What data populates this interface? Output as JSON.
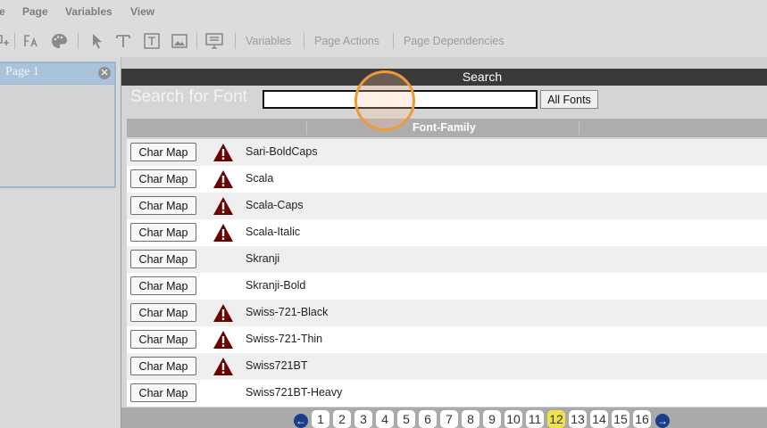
{
  "menu": {
    "items": [
      "e",
      "Page",
      "Variables",
      "View"
    ]
  },
  "toolbar": {
    "variables_label": "Variables",
    "page_actions_label": "Page Actions",
    "page_dependencies_label": "Page Dependencies"
  },
  "page_panel": {
    "title": "Page 1",
    "close_glyph": "✕"
  },
  "dialog": {
    "title": "Search",
    "search_label": "Search for Font",
    "search_value": "",
    "all_fonts_label": "All Fonts",
    "column_header": "Font-Family",
    "char_map_label": "Char Map",
    "rows": [
      {
        "name": "Sari-BoldCaps",
        "warning": true
      },
      {
        "name": "Scala",
        "warning": true
      },
      {
        "name": "Scala-Caps",
        "warning": true
      },
      {
        "name": "Scala-Italic",
        "warning": true
      },
      {
        "name": "Skranji",
        "warning": false
      },
      {
        "name": "Skranji-Bold",
        "warning": false
      },
      {
        "name": "Swiss-721-Black",
        "warning": true
      },
      {
        "name": "Swiss-721-Thin",
        "warning": true
      },
      {
        "name": "Swiss721BT",
        "warning": true
      },
      {
        "name": "Swiss721BT-Heavy",
        "warning": false
      }
    ],
    "warning_icon": "warning-triangle-icon"
  },
  "pagination": {
    "pages": [
      "1",
      "2",
      "3",
      "4",
      "5",
      "6",
      "7",
      "8",
      "9",
      "10",
      "11",
      "12",
      "13",
      "14",
      "15",
      "16"
    ],
    "current": "12",
    "prev_glyph": "←",
    "next_glyph": "→"
  },
  "colors": {
    "title_bar": "#3a3a3a",
    "current_page": "#f0e24a",
    "warning": "#6b0000",
    "cursor_ring": "#ef9a3a"
  }
}
